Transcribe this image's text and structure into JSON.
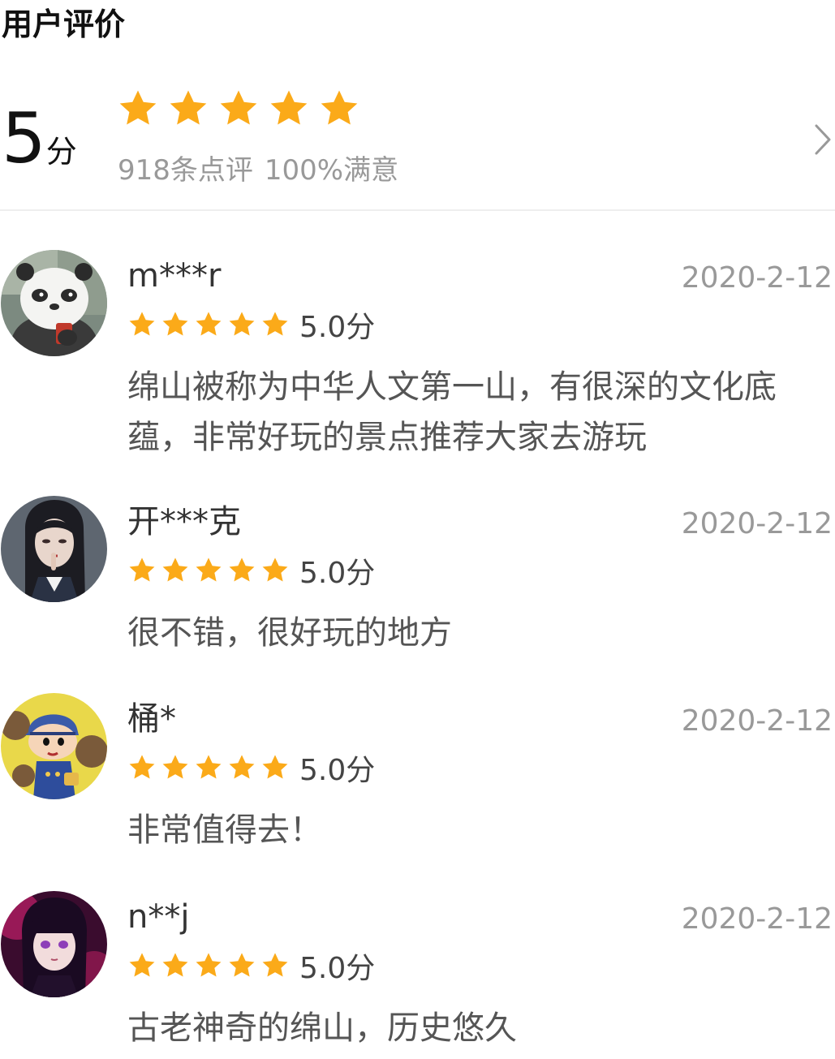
{
  "section_title": "用户评价",
  "summary": {
    "score": "5",
    "score_unit": "分",
    "stars": 5,
    "review_count": "918条点评",
    "satisfaction": "100%满意",
    "chevron_icon": "chevron-right-icon"
  },
  "colors": {
    "star": "#FBAA19",
    "muted_text": "#999999",
    "divider": "#EEEEEE"
  },
  "reviews": [
    {
      "username": "m***r",
      "date": "2020-2-12",
      "stars": 5,
      "rating": "5.0分",
      "content": "绵山被称为中华人文第一山，有很深的文化底蕴，非常好玩的景点推荐大家去游玩",
      "avatar": "panda-avatar"
    },
    {
      "username": "开***克",
      "date": "2020-2-12",
      "stars": 5,
      "rating": "5.0分",
      "content": "很不错，很好玩的地方",
      "avatar": "girl-illustration-avatar"
    },
    {
      "username": "桶*",
      "date": "2020-2-12",
      "stars": 5,
      "rating": "5.0分",
      "content": "非常值得去！",
      "avatar": "cartoon-boy-avatar"
    },
    {
      "username": "n**j",
      "date": "2020-2-12",
      "stars": 5,
      "rating": "5.0分",
      "content": "古老神奇的绵山，历史悠久",
      "avatar": "anime-girl-avatar"
    }
  ]
}
